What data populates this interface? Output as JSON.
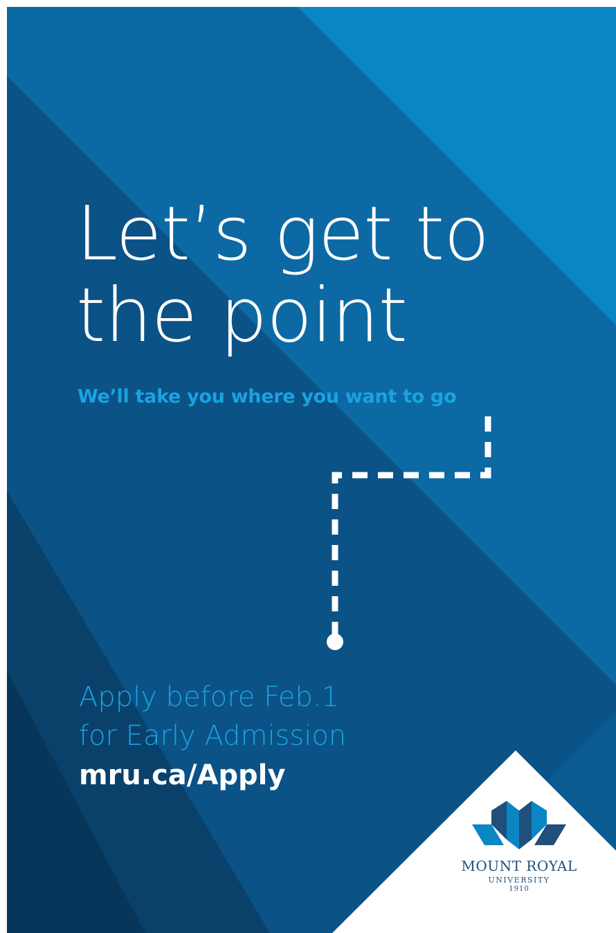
{
  "poster": {
    "headline_line1": "Let’s get to",
    "headline_line2": "the point",
    "tagline": "We’ll take you where you want to go",
    "cta_line1": "Apply before Feb.1",
    "cta_line2": "for Early Admission",
    "url": "mru.ca/Apply"
  },
  "logo": {
    "name": "MOUNT ROYAL",
    "sub": "UNIVERSITY",
    "year": "1910"
  },
  "colors": {
    "background": "#0c5a92",
    "band_light": "#0a86c4",
    "band_mid": "#0d6aa4",
    "band_dark": "#0b4876",
    "band_darkest": "#083a60",
    "accent": "#1aa3e0",
    "text": "#ffffff",
    "logo_text": "#1f4f7c"
  },
  "icons": {
    "route": "dashed-path-icon",
    "logo": "crown-mark-icon"
  }
}
